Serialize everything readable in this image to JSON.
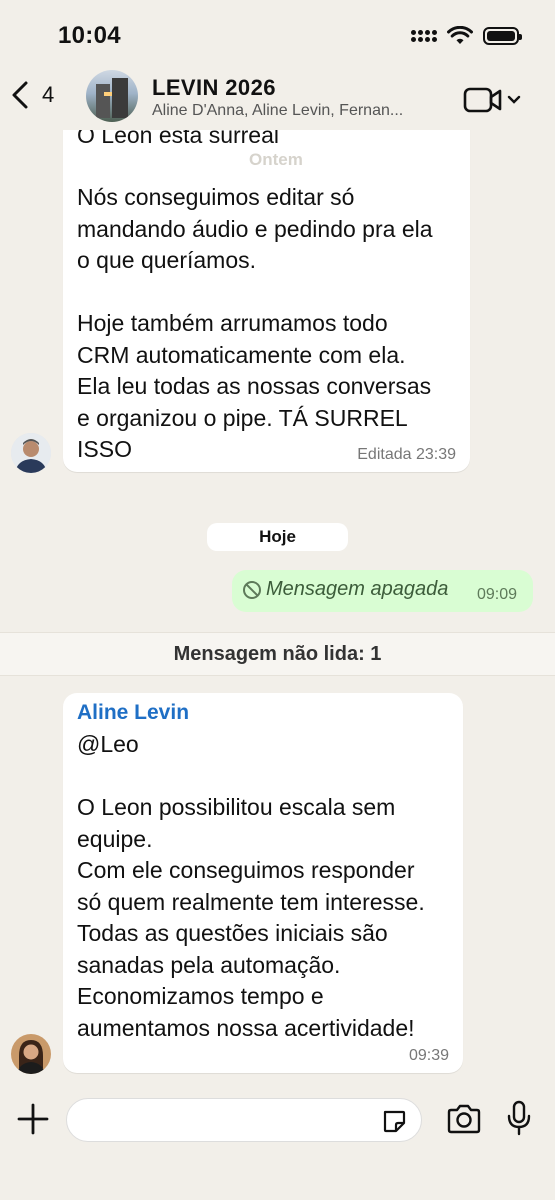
{
  "status_bar": {
    "time": "10:04"
  },
  "header": {
    "back_count": "4",
    "title": "LEVIN 2026",
    "members": "Aline D'Anna, Aline Levin, Fernan..."
  },
  "messages": {
    "first": {
      "top_cut_text": "O Leon esta surreal",
      "overlay_date": "Ontem",
      "body": "Nós conseguimos editar só\nmandando áudio e pedindo pra ela\no que queríamos.\n\nHoje também arrumamos todo\nCRM automaticamente com ela.\nEla leu todas as nossas conversas\ne organizou o pipe. TÁ SURREL\nISSO",
      "meta": "Editada 23:39"
    },
    "date_pill": "Hoje",
    "deleted": {
      "text": "Mensagem apagada",
      "time": "09:09"
    },
    "unread_label": "Mensagem não lida: 1",
    "second": {
      "sender": "Aline Levin",
      "sender_color": "#1f6fc5",
      "body": "@Leo\n\nO Leon possibilitou escala sem\nequipe.\nCom ele conseguimos responder\nsó quem realmente tem interesse.\nTodas as questões iniciais são\nsanadas pela automação.\nEconomizamos tempo e\naumentamos nossa acertividade!",
      "time": "09:39"
    }
  },
  "input": {
    "placeholder": ""
  },
  "icons": [
    "chevron-left-icon",
    "video-camera-icon",
    "chevron-down-icon",
    "deleted-icon",
    "plus-icon",
    "sticker-icon",
    "camera-icon",
    "microphone-icon",
    "signal-icon",
    "wifi-icon",
    "battery-icon"
  ],
  "colors": {
    "background": "#f2efe9",
    "bubble_in": "#ffffff",
    "bubble_out": "#d9fdd3",
    "sender_name": "#1f6fc5"
  }
}
